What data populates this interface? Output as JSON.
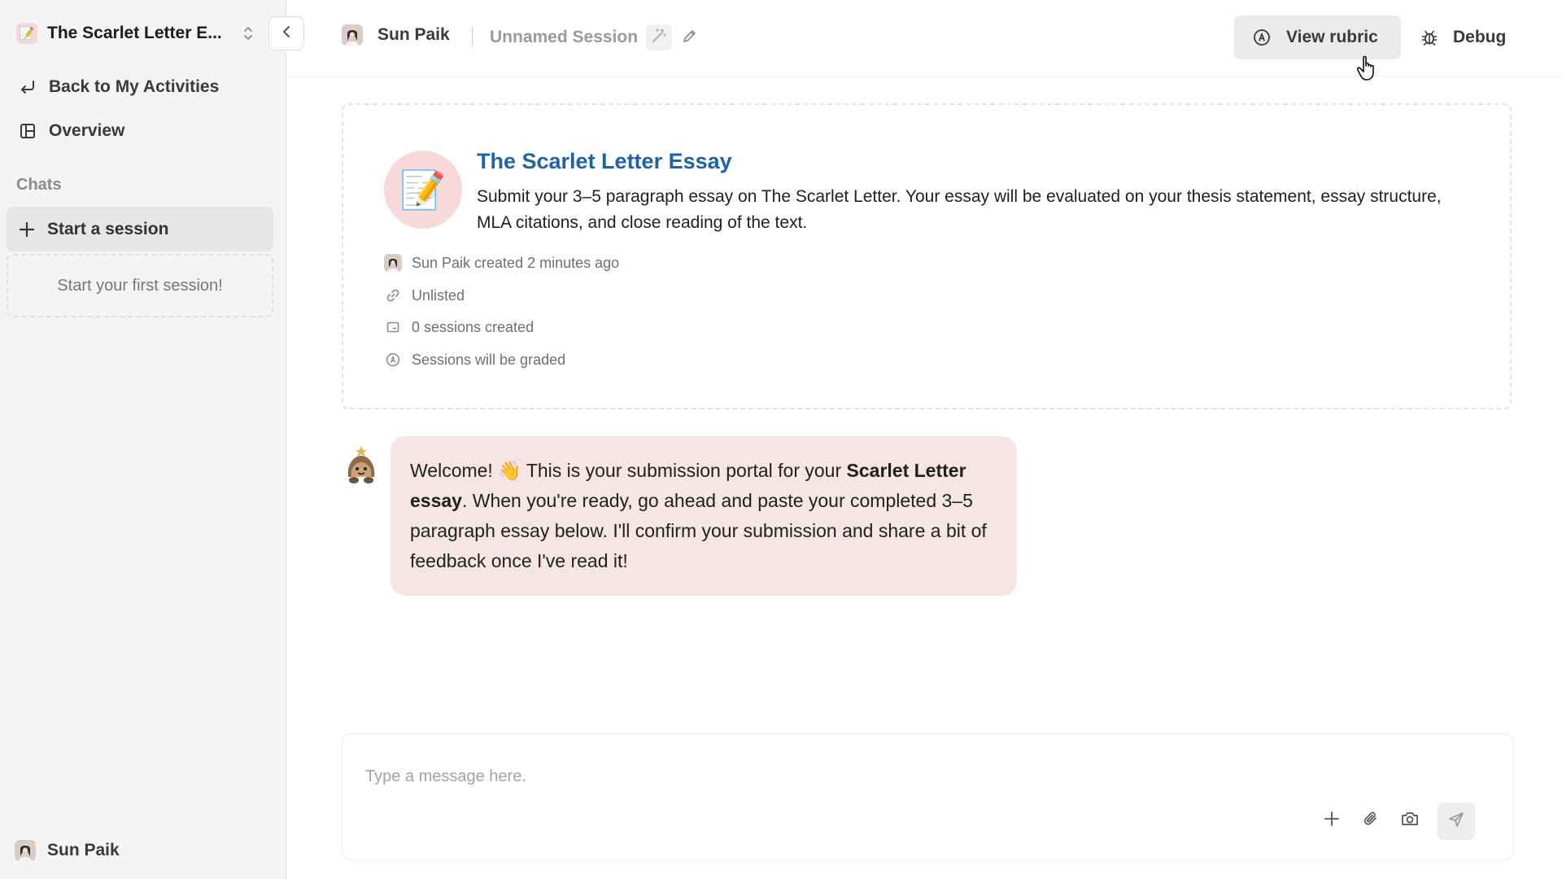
{
  "sidebar": {
    "workspace_title": "The Scarlet Letter E...",
    "workspace_icon": "pencil-memo-emoji",
    "nav": {
      "back_label": "Back to My Activities",
      "overview_label": "Overview"
    },
    "chats_label": "Chats",
    "start_session_label": "Start a session",
    "empty_state": "Start your first session!",
    "footer_user": "Sun Paik"
  },
  "topbar": {
    "user_name": "Sun Paik",
    "session_name": "Unnamed Session",
    "view_rubric_label": "View rubric",
    "debug_label": "Debug"
  },
  "activity": {
    "title": "The Scarlet Letter Essay",
    "description": "Submit your 3–5 paragraph essay on The Scarlet Letter. Your essay will be evaluated on your thesis statement, essay structure, MLA citations, and close reading of the text.",
    "meta": {
      "created": "Sun Paik created 2 minutes ago",
      "visibility": "Unlisted",
      "sessions": "0 sessions created",
      "grading": "Sessions will be graded"
    },
    "title_color": "#1e63a8"
  },
  "chat": {
    "welcome": {
      "p1": "Welcome! 👋 This is your submission portal for your ",
      "b1": "Scarlet Letter essay",
      "p2": ". When you're ready, go ahead and paste your completed 3–5 paragraph essay below. I'll confirm your submission and share a bit of feedback once I've read it!"
    },
    "bubble_color": "#f5e6e5"
  },
  "composer": {
    "placeholder": "Type a message here."
  }
}
